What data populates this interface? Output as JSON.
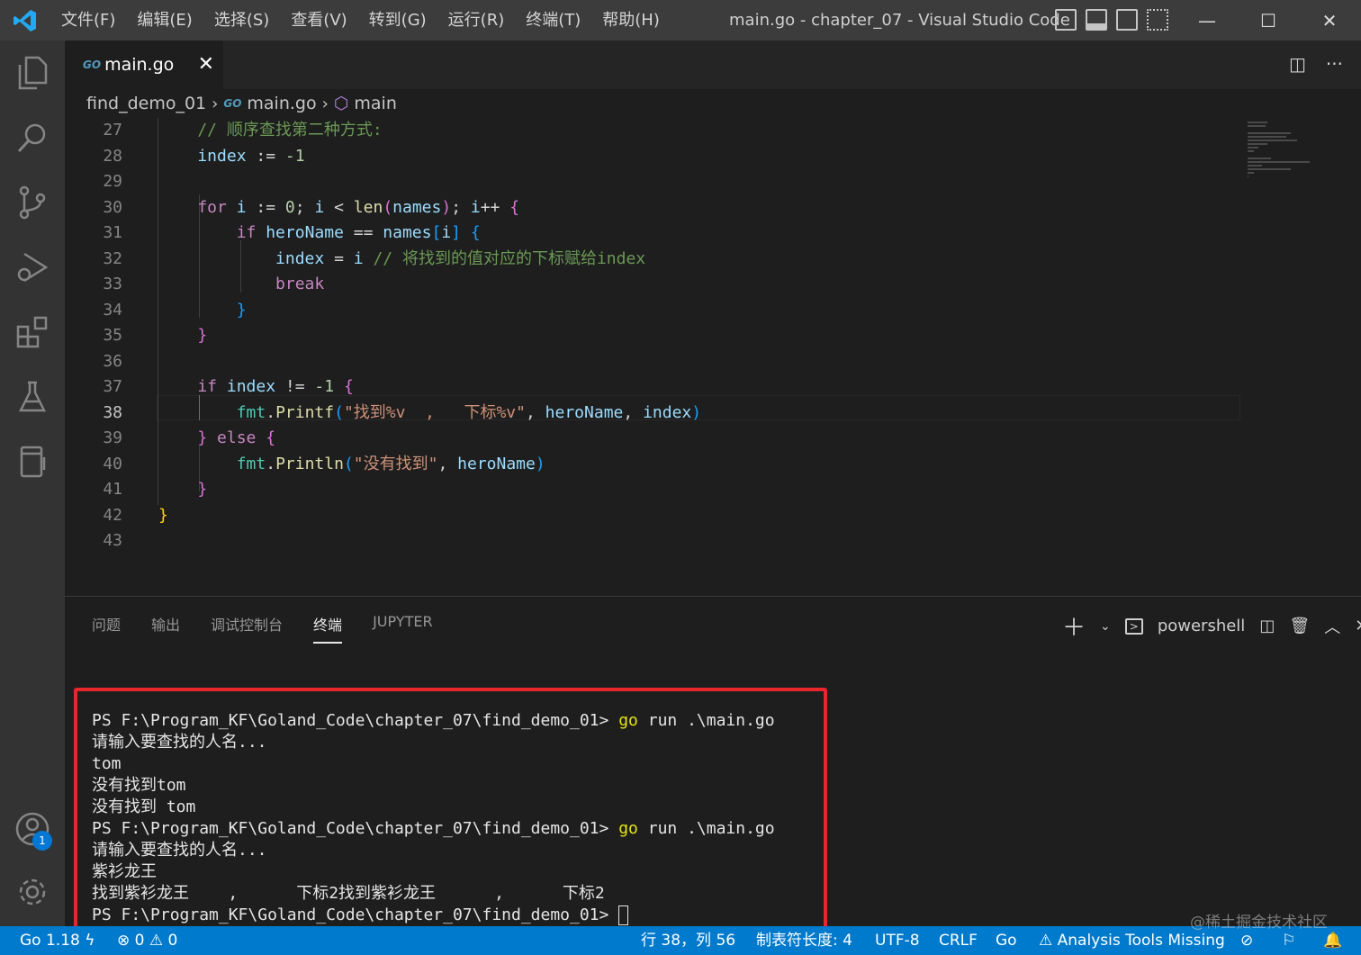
{
  "app": {
    "window_title": "main.go - chapter_07 - Visual Studio Code",
    "menu": [
      "文件(F)",
      "编辑(E)",
      "选择(S)",
      "查看(V)",
      "转到(G)",
      "运行(R)",
      "终端(T)",
      "帮助(H)"
    ],
    "controls": {
      "minimize": "—",
      "maximize": "☐",
      "close": "✕"
    }
  },
  "activity_bar": {
    "icons": [
      "files-icon",
      "search-icon",
      "source-control-icon",
      "run-debug-icon",
      "extensions-icon",
      "testing-icon",
      "remote-icon"
    ],
    "account_badge": "1"
  },
  "tab": {
    "icon_text": "GO",
    "label": "main.go",
    "close": "✕"
  },
  "breadcrumb": {
    "folder": "find_demo_01",
    "file_icon": "GO",
    "file": "main.go",
    "symbol": "main"
  },
  "editor": {
    "current_line": 38,
    "lines": [
      {
        "n": "27",
        "tokens": [
          [
            "cmt",
            "    // 顺序查找第二种方式:"
          ]
        ]
      },
      {
        "n": "28",
        "tokens": [
          [
            "var",
            "    index"
          ],
          [
            "",
            " := "
          ],
          [
            "num",
            "-1"
          ]
        ]
      },
      {
        "n": "29",
        "tokens": []
      },
      {
        "n": "30",
        "tokens": [
          [
            "kw",
            "    for"
          ],
          [
            "",
            " "
          ],
          [
            "var",
            "i"
          ],
          [
            "",
            " := "
          ],
          [
            "num",
            "0"
          ],
          [
            "",
            "; "
          ],
          [
            "var",
            "i"
          ],
          [
            "",
            " < "
          ],
          [
            "fn",
            "len"
          ],
          [
            "b2",
            "("
          ],
          [
            "var",
            "names"
          ],
          [
            "b2",
            ")"
          ],
          [
            "",
            "; "
          ],
          [
            "var",
            "i"
          ],
          [
            "",
            "++ "
          ],
          [
            "b2",
            "{"
          ]
        ]
      },
      {
        "n": "31",
        "tokens": [
          [
            "kw",
            "        if"
          ],
          [
            "",
            " "
          ],
          [
            "var",
            "heroName"
          ],
          [
            "",
            " == "
          ],
          [
            "var",
            "names"
          ],
          [
            "b3",
            "["
          ],
          [
            "var",
            "i"
          ],
          [
            "b3",
            "]"
          ],
          [
            "",
            " "
          ],
          [
            "b3",
            "{"
          ]
        ]
      },
      {
        "n": "32",
        "tokens": [
          [
            "var",
            "            index"
          ],
          [
            "",
            " = "
          ],
          [
            "var",
            "i"
          ],
          [
            "",
            " "
          ],
          [
            "cmt",
            "// 将找到的值对应的下标赋给index"
          ]
        ]
      },
      {
        "n": "33",
        "tokens": [
          [
            "kw",
            "            break"
          ]
        ]
      },
      {
        "n": "34",
        "tokens": [
          [
            "b3",
            "        }"
          ]
        ]
      },
      {
        "n": "35",
        "tokens": [
          [
            "b2",
            "    }"
          ]
        ]
      },
      {
        "n": "36",
        "tokens": []
      },
      {
        "n": "37",
        "tokens": [
          [
            "kw",
            "    if"
          ],
          [
            "",
            " "
          ],
          [
            "var",
            "index"
          ],
          [
            "",
            " != "
          ],
          [
            "num",
            "-1"
          ],
          [
            "",
            " "
          ],
          [
            "b2",
            "{"
          ]
        ]
      },
      {
        "n": "38",
        "tokens": [
          [
            "pkg",
            "        fmt"
          ],
          [
            "",
            "."
          ],
          [
            "fn",
            "Printf"
          ],
          [
            "b3",
            "("
          ],
          [
            "str",
            "\"找到%v  ,   下标%v\""
          ],
          [
            "",
            ", "
          ],
          [
            "var",
            "heroName"
          ],
          [
            "",
            ", "
          ],
          [
            "var",
            "index"
          ],
          [
            "b3",
            ")"
          ]
        ]
      },
      {
        "n": "39",
        "tokens": [
          [
            "b2",
            "    }"
          ],
          [
            "",
            " "
          ],
          [
            "kw",
            "else"
          ],
          [
            "",
            " "
          ],
          [
            "b2",
            "{"
          ]
        ]
      },
      {
        "n": "40",
        "tokens": [
          [
            "pkg",
            "        fmt"
          ],
          [
            "",
            "."
          ],
          [
            "fn",
            "Println"
          ],
          [
            "b3",
            "("
          ],
          [
            "str",
            "\"没有找到\""
          ],
          [
            "",
            ", "
          ],
          [
            "var",
            "heroName"
          ],
          [
            "b3",
            ")"
          ]
        ]
      },
      {
        "n": "41",
        "tokens": [
          [
            "b2",
            "    }"
          ]
        ]
      },
      {
        "n": "42",
        "tokens": [
          [
            "b1",
            "}"
          ]
        ]
      },
      {
        "n": "43",
        "tokens": []
      }
    ]
  },
  "panel": {
    "tabs": [
      "问题",
      "输出",
      "调试控制台",
      "终端",
      "JUPYTER"
    ],
    "active_tab": "终端",
    "shell": "powershell",
    "terminal_lines": [
      [
        [
          "",
          "PS F:\\Program_KF\\Goland_Code\\chapter_07\\find_demo_01> "
        ],
        [
          "t-yellow",
          "go"
        ],
        [
          "",
          " run .\\main.go"
        ]
      ],
      [
        [
          "",
          "请输入要查找的人名..."
        ]
      ],
      [
        [
          "",
          "tom"
        ]
      ],
      [
        [
          "",
          "没有找到tom"
        ]
      ],
      [
        [
          "",
          "没有找到 tom"
        ]
      ],
      [
        [
          "",
          "PS F:\\Program_KF\\Goland_Code\\chapter_07\\find_demo_01> "
        ],
        [
          "t-yellow",
          "go"
        ],
        [
          "",
          " run .\\main.go"
        ]
      ],
      [
        [
          "",
          "请输入要查找的人名..."
        ]
      ],
      [
        [
          "",
          "紫衫龙王"
        ]
      ],
      [
        [
          "",
          "找到紫衫龙王    ,      下标2找到紫衫龙王      ,      下标2"
        ]
      ],
      [
        [
          "",
          "PS F:\\Program_KF\\Goland_Code\\chapter_07\\find_demo_01> "
        ],
        [
          "cursor",
          ""
        ]
      ]
    ]
  },
  "statusbar": {
    "go_version": "Go 1.18",
    "problems": "⊗ 0 ⚠ 0",
    "position": "行 38，列 56",
    "tab_size": "制表符长度: 4",
    "encoding": "UTF-8",
    "eol": "CRLF",
    "language": "Go",
    "analysis": "⚠ Analysis Tools Missing"
  },
  "watermark": "@稀土掘金技术社区",
  "colors": {
    "accent": "#007acc",
    "highlight_box": "#e8262b"
  }
}
